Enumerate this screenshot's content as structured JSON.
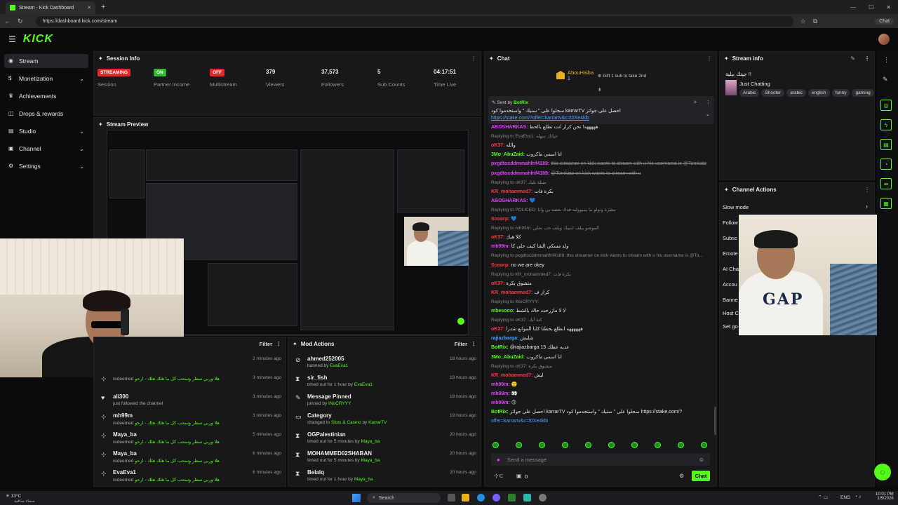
{
  "browser": {
    "tab_title": "Stream - Kick Dashboard",
    "url": "https://dashboard.kick.com/stream",
    "chat_pill": "Chat"
  },
  "brand": {
    "logo": "KICK",
    "accent": "#53fc18"
  },
  "sidebar": {
    "items": [
      {
        "label": "Stream",
        "icon": "broadcast-icon",
        "active": true,
        "chevron": false
      },
      {
        "label": "Monetization",
        "icon": "dollar-icon",
        "active": false,
        "chevron": true
      },
      {
        "label": "Achievements",
        "icon": "trophy-icon",
        "active": false,
        "chevron": false
      },
      {
        "label": "Drops & rewards",
        "icon": "gift-icon",
        "active": false,
        "chevron": false
      },
      {
        "label": "Studio",
        "icon": "studio-icon",
        "active": false,
        "chevron": true
      },
      {
        "label": "Channel",
        "icon": "channel-icon",
        "active": false,
        "chevron": true
      },
      {
        "label": "Settings",
        "icon": "gear-icon",
        "active": false,
        "chevron": true
      }
    ]
  },
  "session": {
    "title": "Session Info",
    "stats": [
      {
        "value": "STREAMING",
        "label": "Session",
        "badge": "red"
      },
      {
        "value": "ON",
        "label": "Partner Income",
        "badge": "green"
      },
      {
        "value": "OFF",
        "label": "Multistream",
        "badge": "red"
      },
      {
        "value": "379",
        "label": "Viewers",
        "badge": ""
      },
      {
        "value": "37,573",
        "label": "Followers",
        "badge": ""
      },
      {
        "value": "5",
        "label": "Sub Counts",
        "badge": ""
      },
      {
        "value": "04:17:51",
        "label": "Time Live",
        "badge": ""
      }
    ]
  },
  "preview": {
    "title": "Stream Preview"
  },
  "activity": {
    "filter_label": "Filter",
    "rows": [
      {
        "icon": "",
        "name": "",
        "sub": "",
        "time": "2 minutes ago"
      },
      {
        "icon": "gift-icon",
        "name": "",
        "sub_prefix": "redeemed",
        "sub_green": "هلا وربي سطر وسحب كل ما هلك هلك - ارحو",
        "time": "3 minutes ago"
      },
      {
        "icon": "heart-icon",
        "name": "ali300",
        "sub_prefix": "just followed the channel",
        "sub_green": "",
        "time": "3 minutes ago"
      },
      {
        "icon": "gift-icon",
        "name": "mh99m",
        "sub_prefix": "redeemed",
        "sub_green": "هلا وربي سطر وسحب كل ما هلك هلك - ارحو",
        "time": "3 minutes ago"
      },
      {
        "icon": "gift-icon",
        "name": "Maya_ba",
        "sub_prefix": "redeemed",
        "sub_green": "هلا وربي سطر وسحب كل ما هلك هلك - ارحو",
        "time": "5 minutes ago"
      },
      {
        "icon": "gift-icon",
        "name": "Maya_ba",
        "sub_prefix": "redeemed",
        "sub_green": "هلا وربي سطر وسحب كل ما هلك هلك - ارحو",
        "time": "6 minutes ago"
      },
      {
        "icon": "gift-icon",
        "name": "EvaEva1",
        "sub_prefix": "redeemed",
        "sub_green": "هلا وربي سطر وسحب كل ما هلك هلك - ارحو",
        "time": "6 minutes ago"
      }
    ]
  },
  "mod_actions": {
    "title": "Mod Actions",
    "filter_label": "Filter",
    "rows": [
      {
        "icon": "ban-icon",
        "name": "ahmed252005",
        "sub_prefix": "banned by",
        "sub_green": "EvaEva1",
        "time": "18 hours ago"
      },
      {
        "icon": "hourglass-icon",
        "name": "sir_fish",
        "sub_prefix": "timed out for 1 hour by",
        "sub_green": "EvaEva1",
        "time": "19 hours ago"
      },
      {
        "icon": "pin-icon",
        "name": "Message Pinned",
        "sub_prefix": "pinned by",
        "sub_green": "INoCRYYY",
        "time": "19 hours ago"
      },
      {
        "icon": "category-icon",
        "name": "Category",
        "sub_prefix": "changed to",
        "sub_green": "Slots & Casino",
        "sub_suffix": "by",
        "sub_green2": "KarrarTV",
        "time": "19 hours ago"
      },
      {
        "icon": "hourglass-icon",
        "name": "OGPalestinian",
        "sub_prefix": "timed out for 5 minutes by",
        "sub_green": "Maya_ba",
        "time": "20 hours ago"
      },
      {
        "icon": "hourglass-icon",
        "name": "MOHAMMED02SHABAN",
        "sub_prefix": "timed out for 5 minutes by",
        "sub_green": "Maya_ba",
        "time": "20 hours ago"
      },
      {
        "icon": "hourglass-icon",
        "name": "Belalq",
        "sub_prefix": "timed out for 1 hour by",
        "sub_green": "Maya_ba",
        "time": "20 hours ago"
      }
    ]
  },
  "chat": {
    "title": "Chat",
    "top_gifter": "AbouHaiba",
    "top_gifter_count": "1",
    "gift_hint": "Gift 1 sub to take 2nd",
    "pinned_sender_prefix": "Sent by",
    "pinned_sender": "BotRix",
    "pinned_text": "احصل على جوائز karrarTV سجلوا على \" ستيك \" واستخدموا كود",
    "pinned_link": "https://stake.com/?offer=karrartv&c=t0Xe4klb",
    "messages": [
      {
        "reply": "",
        "user": "ABOSHARKAS:",
        "color": "#e040fb",
        "text": "هههههه! نحن كرار انت تطلع بالحظ"
      },
      {
        "reply": "Replying to EvaEva1: حياتك سهله",
        "user": "",
        "color": "",
        "text": ""
      },
      {
        "reply": "",
        "user": "oK37:",
        "color": "#ff3b3b",
        "text": "والله"
      },
      {
        "reply": "",
        "user": "3Mo_AbuZaid:",
        "color": "#53fc18",
        "text": "انا اسمي ماكروب"
      },
      {
        "reply": "",
        "user": "pxgdtocddmmahfnf4189:",
        "color": "#e040fb",
        "text": "this streamer on kick wants to stream with u his username is @Tomkatz",
        "deleted": true
      },
      {
        "reply": "",
        "user": "pxgdtocddmmahfnf4189:",
        "color": "#e040fb",
        "text": "@Tomkatz on kick wants to stream with u",
        "deleted": true
      },
      {
        "reply": "Replying to oK37: مبتلة بلياد",
        "user": "",
        "color": "",
        "text": ""
      },
      {
        "reply": "",
        "user": "KR_mohammed7:",
        "color": "#ff3b3b",
        "text": "بكرة فات"
      },
      {
        "reply": "",
        "user": "ABOSHARKAS:",
        "color": "#e040fb",
        "text": "💙"
      },
      {
        "reply": "Replying to POLICED: بنطرة وتولو ما يسووليه قدك بعضه بي وانا",
        "user": "",
        "color": "",
        "text": ""
      },
      {
        "reply": "",
        "user": "Scoorp:",
        "color": "#ff3b3b",
        "text": "💙"
      },
      {
        "reply": "Replying to mh99m: الموضو يبلف ابنيبك وبلف حب نحلي",
        "user": "",
        "color": "",
        "text": ""
      },
      {
        "reply": "",
        "user": "oK37:",
        "color": "#ff3b3b",
        "text": "كلا هيك"
      },
      {
        "reply": "",
        "user": "mh99m:",
        "color": "#e040fb",
        "text": "ولد مسكي الشا كيف حلى كا"
      },
      {
        "reply": "Replying to pxgdtocddmmahfnf4189: this streamer on kick wants to stream with u his username is @To...",
        "user": "",
        "color": "",
        "text": ""
      },
      {
        "reply": "",
        "user": "Scoorp:",
        "color": "#ff3b3b",
        "text": "no we are okey"
      },
      {
        "reply": "Replying to KR_mohammed7: بكرة فات",
        "user": "",
        "color": "",
        "text": ""
      },
      {
        "reply": "",
        "user": "oK37:",
        "color": "#ff3b3b",
        "text": "متشوق بكرة"
      },
      {
        "reply": "",
        "user": "KR_mohammed7:",
        "color": "#ff3b3b",
        "text": "كرار ف"
      },
      {
        "reply": "Replying to INoCRYYY:",
        "user": "",
        "color": "",
        "text": ""
      },
      {
        "reply": "",
        "user": "mbesooo:",
        "color": "#53fc18",
        "text": "لا لا مازرحت حاك بالشط"
      },
      {
        "reply": "Replying to oK37: كنة أبك",
        "user": "",
        "color": "",
        "text": ""
      },
      {
        "reply": "",
        "user": "oK37:",
        "color": "#ff3b3b",
        "text": "ههههههه انطلع بحظنا كلنا الموانع شدرا"
      },
      {
        "reply": "",
        "user": "rajiazbarga:",
        "color": "#4aa3ff",
        "text": "شلبش"
      },
      {
        "reply": "",
        "user": "BotRix:",
        "color": "#53fc18",
        "text": "@rajiazbarga 15 عديه عطك"
      },
      {
        "reply": "",
        "user": "3Mo_AbuZaid:",
        "color": "#53fc18",
        "text": "انا اسمي ماكروب"
      },
      {
        "reply": "Replying to oK37: متشوق بكرة",
        "user": "",
        "color": "",
        "text": ""
      },
      {
        "reply": "",
        "user": "KR_mohammed7:",
        "color": "#ff3b3b",
        "text": "ليش"
      },
      {
        "reply": "",
        "user": "mh99m:",
        "color": "#e040fb",
        "text": "🙂"
      },
      {
        "reply": "",
        "user": "mh99m:",
        "color": "#e040fb",
        "text": "👀"
      },
      {
        "reply": "",
        "user": "mh99m:",
        "color": "#e040fb",
        "text": "🙃"
      },
      {
        "reply": "",
        "user": "BotRix:",
        "color": "#53fc18",
        "text": "احصل على جوائز karrarTV سجلوا على \" ستيك \" واستخدموا كود https://stake.com/?"
      },
      {
        "reply": "",
        "user": "",
        "color": "",
        "text": "offer=karrartv&c=t0Xe4klb"
      }
    ],
    "input_placeholder": "Send a message",
    "points_count": "0",
    "send_label": "Chat"
  },
  "stream_info": {
    "title": "Stream info",
    "stream_title": "جيتك بيلية !!",
    "category": "Just Chatting",
    "tags": [
      "Arabic",
      "Shooter",
      "arabic",
      "english",
      "funny",
      "gaming"
    ]
  },
  "channel_actions": {
    "title": "Channel Actions",
    "items": [
      "Slow mode",
      "Follow",
      "Subsc",
      "Emote",
      "AI Cha",
      "Accou",
      "Banne",
      "Host C",
      "Set go"
    ]
  },
  "taskbar": {
    "weather_temp": "13°C",
    "weather_desc": "سماء صافية",
    "search_label": "Search",
    "lang": "ENG",
    "time": "10:01 PM",
    "date": "1/5/2026"
  }
}
